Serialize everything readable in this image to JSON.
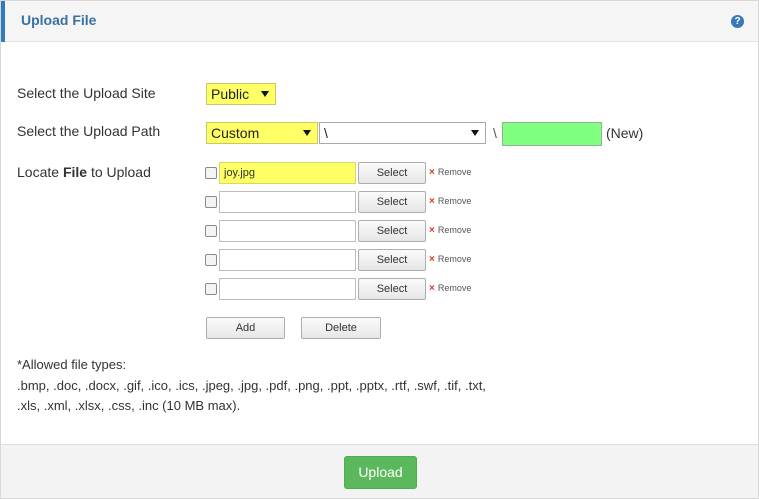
{
  "header": {
    "title": "Upload File",
    "help_icon": "question-circle-icon",
    "help_glyph": "?"
  },
  "site": {
    "label": "Select the Upload Site",
    "value": "Public"
  },
  "path": {
    "label": "Select the Upload Path",
    "type_value": "Custom",
    "folder_value": "\\",
    "separator": "\\",
    "new_folder_value": "",
    "new_label": "(New)"
  },
  "locate": {
    "label_prefix": "Locate",
    "label_bold": "File",
    "label_suffix": "to Upload"
  },
  "files": [
    {
      "value": "joy.jpg",
      "select_label": "Select",
      "remove_label": "Remove"
    },
    {
      "value": "",
      "select_label": "Select",
      "remove_label": "Remove"
    },
    {
      "value": "",
      "select_label": "Select",
      "remove_label": "Remove"
    },
    {
      "value": "",
      "select_label": "Select",
      "remove_label": "Remove"
    },
    {
      "value": "",
      "select_label": "Select",
      "remove_label": "Remove"
    }
  ],
  "remove_glyph": "×",
  "actions": {
    "add_label": "Add",
    "delete_label": "Delete"
  },
  "allowed": {
    "heading": "*Allowed file types:",
    "line1": ".bmp, .doc, .docx, .gif, .ico, .ics, .jpeg, .jpg, .pdf, .png, .ppt, .pptx, .rtf, .swf, .tif, .txt,",
    "line2": ".xls, .xml, .xlsx, .css, .inc (10 MB max)."
  },
  "footer": {
    "upload_label": "Upload"
  },
  "colors": {
    "accent": "#2f7bbf",
    "highlight": "#ffff66",
    "new_folder_bg": "#80ff80",
    "upload_button": "#5cb85c"
  }
}
